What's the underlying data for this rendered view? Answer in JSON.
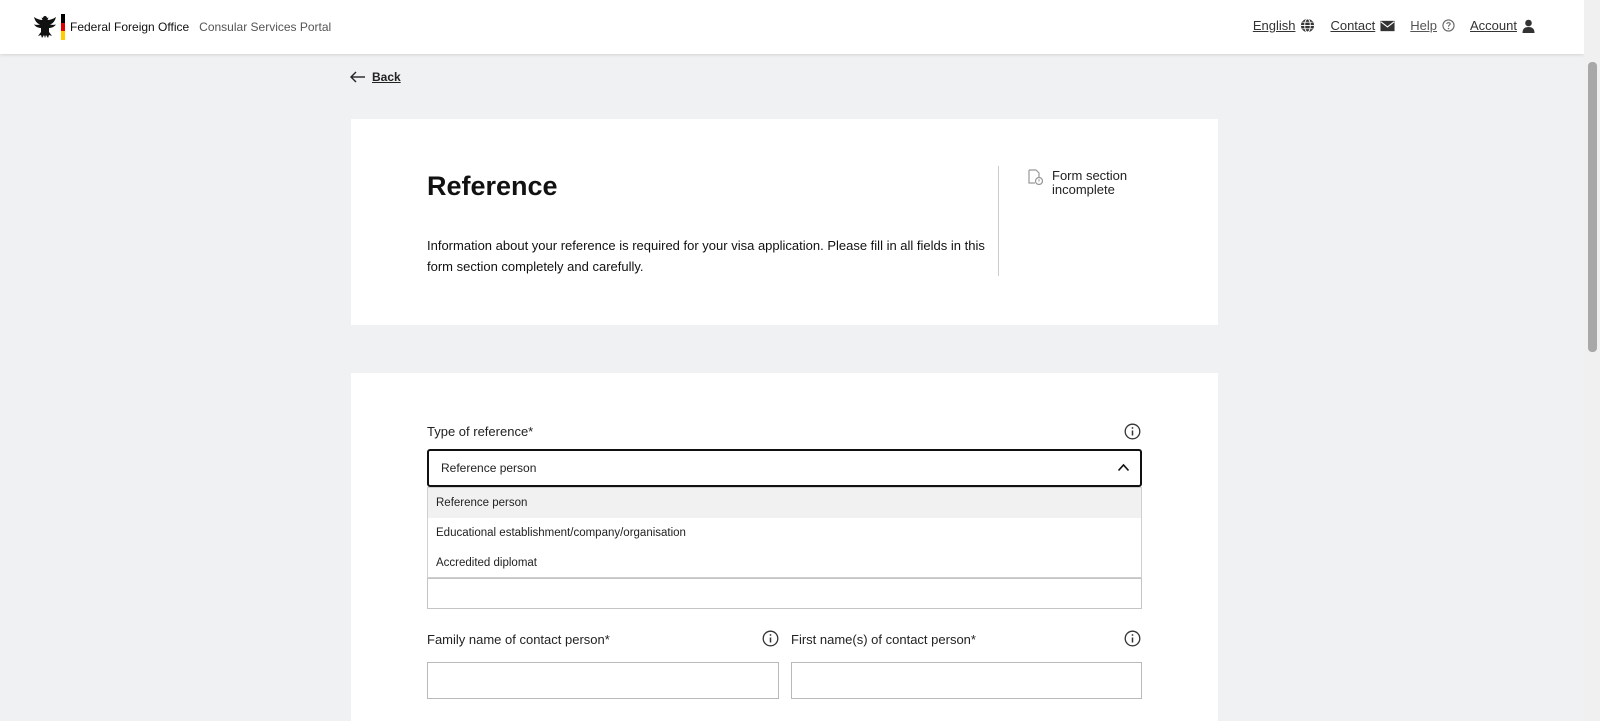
{
  "header": {
    "brand_name": "Federal Foreign Office",
    "portal_name": "Consular Services Portal",
    "nav": {
      "language": "English",
      "contact": "Contact",
      "help": "Help",
      "account": "Account"
    }
  },
  "back_label": "Back",
  "intro": {
    "title": "Reference",
    "description": "Information about your reference is required for your visa application. Please fill in all fields in this form section completely and carefully.",
    "status": "Form section incomplete"
  },
  "form": {
    "type_of_reference": {
      "label": "Type of reference*",
      "selected": "Reference person",
      "options": [
        "Reference person",
        "Educational establishment/company/organisation",
        "Accredited diplomat"
      ]
    },
    "family_name_label": "Family name of contact person*",
    "first_name_label": "First name(s) of contact person*"
  },
  "colors": {
    "page_bg": "#f0f1f2",
    "flag_black": "#000000",
    "flag_red": "#dd0000",
    "flag_gold": "#ffcc00"
  }
}
